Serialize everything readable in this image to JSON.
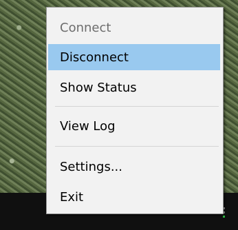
{
  "menu": {
    "items": [
      {
        "label": "Connect",
        "state": "disabled"
      },
      {
        "label": "Disconnect",
        "state": "highlighted"
      },
      {
        "label": "Show Status",
        "state": "normal"
      },
      {
        "label": "View Log",
        "state": "normal"
      },
      {
        "label": "Settings...",
        "state": "normal"
      },
      {
        "label": "Exit",
        "state": "normal"
      }
    ]
  },
  "colors": {
    "highlight": "#99c9ef",
    "menu_background": "#f2f2f2",
    "disabled_text": "#6d6d6d",
    "tray_status": "#2fbf45"
  }
}
